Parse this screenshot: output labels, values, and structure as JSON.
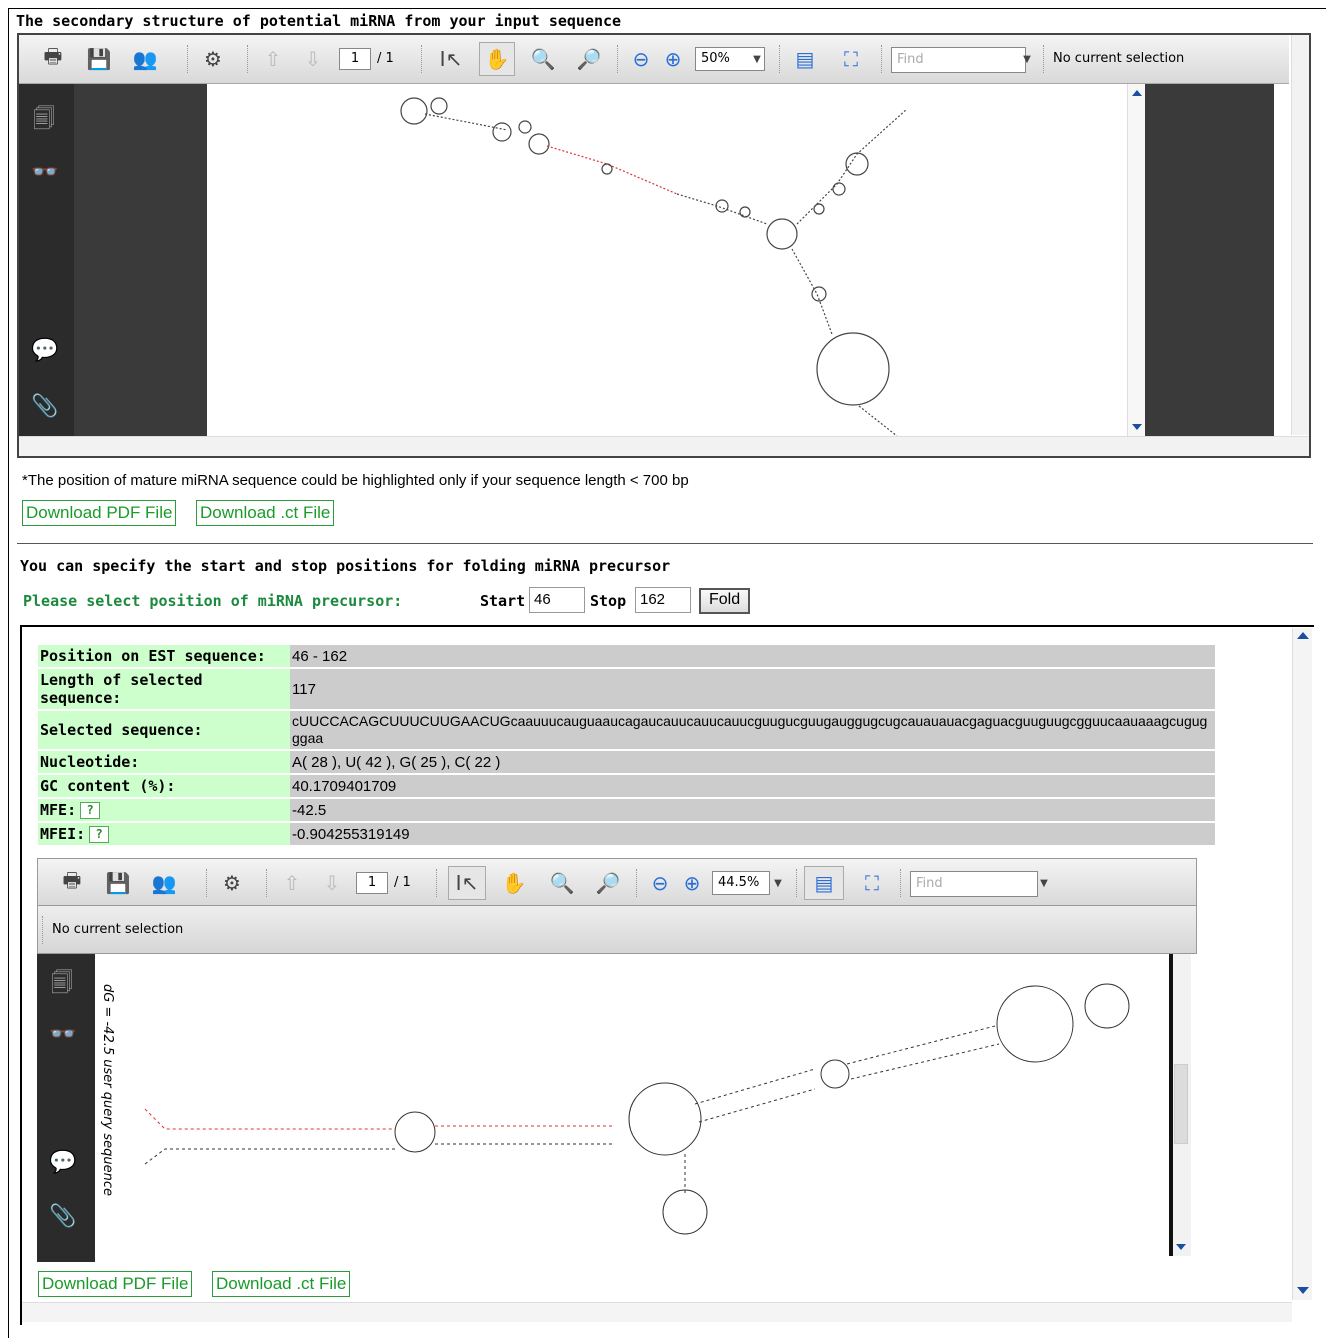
{
  "section1": {
    "title": "The secondary structure of potential miRNA from your input sequence"
  },
  "viewer1": {
    "page_current": "1",
    "page_total": "/ 1",
    "zoom": "50%",
    "find_placeholder": "Find",
    "status": "No current selection"
  },
  "note": "*The position of mature miRNA sequence could be highlighted only if your sequence length < 700 bp",
  "downloads1": {
    "pdf": "Download PDF File",
    "ct": "Download .ct File"
  },
  "fold_section": {
    "heading": "You can specify the start and stop positions for folding miRNA precursor",
    "prompt": "Please select position of miRNA precursor:",
    "start_label": "Start",
    "start_value": "46",
    "stop_label": "Stop",
    "stop_value": "162",
    "fold_button": "Fold"
  },
  "info": {
    "position_label": "Position on EST sequence:",
    "position_value": "46 - 162",
    "length_label": "Length of selected sequence:",
    "length_value": "117",
    "sequence_label": "Selected sequence:",
    "sequence_value": "cUUCCACAGCUUUCUUGAACUGcaauuucauguaaucagaucauucauucauucguugucguugauggugcugcauauauacgaguacguuguugcgguucaauaaagcugugggaa",
    "nucleotide_label": "Nucleotide:",
    "nucleotide_value": "A( 28 ), U( 42 ), G( 25 ), C( 22 )",
    "gc_label": "GC content (%):",
    "gc_value": "40.1709401709",
    "mfe_label": "MFE:",
    "mfe_value": "-42.5",
    "mfei_label": "MFEI:",
    "mfei_value": "-0.904255319149",
    "help_glyph": "?"
  },
  "viewer2": {
    "page_current": "1",
    "page_total": "/ 1",
    "zoom": "44.5%",
    "find_placeholder": "Find",
    "status": "No current selection",
    "plot_caption": "dG = -42.5 user query sequence"
  },
  "downloads2": {
    "pdf": "Download PDF File",
    "ct": "Download .ct File"
  },
  "colors": {
    "green_text": "#199b2a",
    "label_bg": "#ccffcc",
    "value_bg": "#cccccc"
  }
}
